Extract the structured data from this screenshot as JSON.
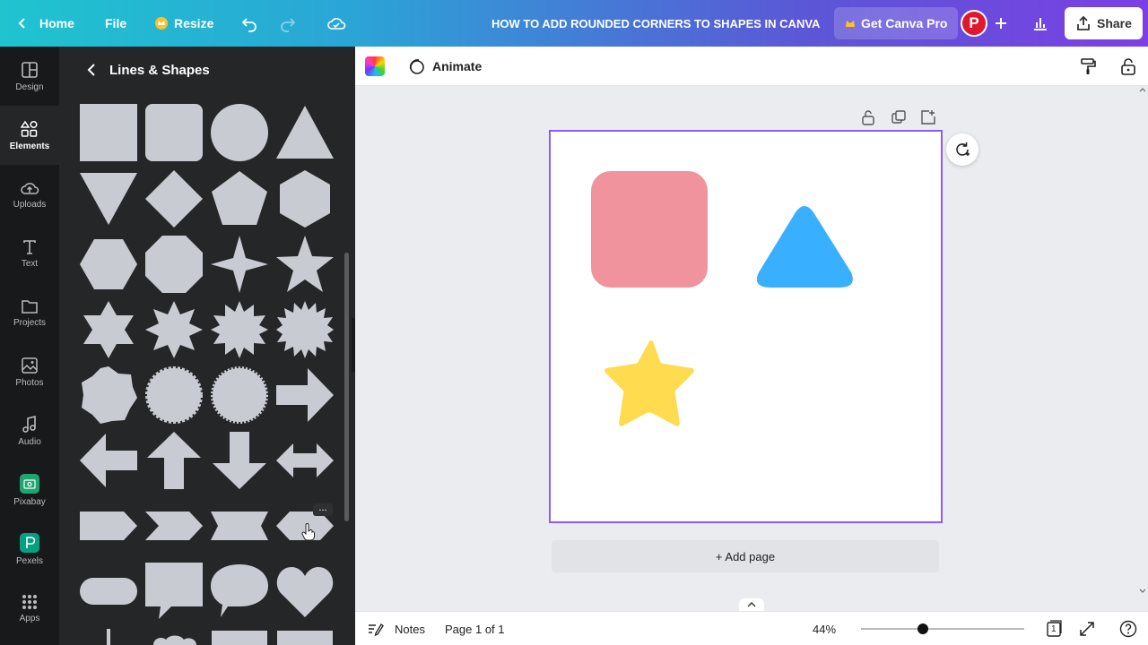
{
  "topbar": {
    "home_label": "Home",
    "file_label": "File",
    "resize_label": "Resize",
    "doc_title": "HOW TO ADD ROUNDED CORNERS TO SHAPES IN CANVA",
    "pro_label": "Get Canva Pro",
    "avatar_initial": "P",
    "share_label": "Share"
  },
  "rail": {
    "items": [
      {
        "label": "Design",
        "icon": "design-icon"
      },
      {
        "label": "Elements",
        "icon": "elements-icon",
        "active": true
      },
      {
        "label": "Uploads",
        "icon": "uploads-icon"
      },
      {
        "label": "Text",
        "icon": "text-icon"
      },
      {
        "label": "Projects",
        "icon": "projects-icon"
      },
      {
        "label": "Photos",
        "icon": "photos-icon"
      },
      {
        "label": "Audio",
        "icon": "audio-icon"
      },
      {
        "label": "Pixabay",
        "icon": "pixabay-icon"
      },
      {
        "label": "Pexels",
        "icon": "pexels-icon"
      },
      {
        "label": "Apps",
        "icon": "apps-icon"
      }
    ]
  },
  "panel": {
    "title": "Lines & Shapes",
    "shape_color": "#c8ccd2",
    "more_label": "..."
  },
  "editor": {
    "animate_label": "Animate",
    "add_page_label": "+ Add page",
    "shapes": [
      {
        "name": "rounded-square",
        "color": "#f0939d"
      },
      {
        "name": "rounded-triangle",
        "color": "#39b0ff"
      },
      {
        "name": "rounded-star",
        "color": "#ffdb4f"
      }
    ]
  },
  "bottombar": {
    "notes_label": "Notes",
    "page_label": "Page 1 of 1",
    "zoom_label": "44%",
    "zoom_fraction": 0.38,
    "page_count": "1"
  },
  "colors": {
    "accent": "#8b5cf6",
    "dark_panel": "#252627",
    "rail": "#18191b"
  }
}
